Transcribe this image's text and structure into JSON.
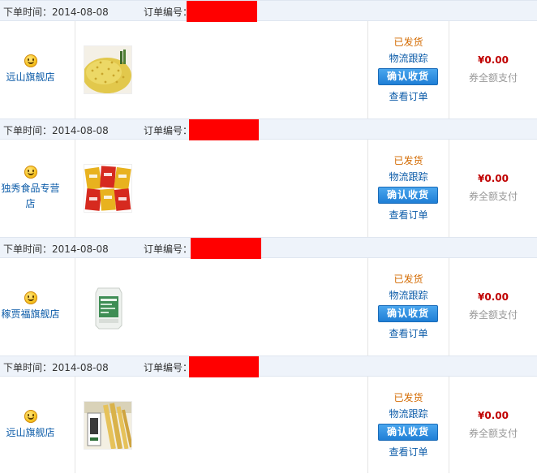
{
  "labels": {
    "date_prefix": "下单时间：",
    "order_no_label": "订单编号：",
    "status": "已发货",
    "track": "物流跟踪",
    "confirm": "确认收货",
    "view": "查看订单",
    "amount": "¥0.00",
    "paytype": "券全额支付"
  },
  "colors": {
    "header_bg": "#eef3fa",
    "redaction": "#ff0000",
    "status": "#d36a00",
    "link": "#0b5ba8",
    "price": "#c00000",
    "button": "#1f7fd6"
  },
  "orders": [
    {
      "date": "2014-08-08",
      "shop": "远山旗舰店",
      "product_icon": "millet-grain-image"
    },
    {
      "date": "2014-08-08",
      "shop": "独秀食品专营店",
      "product_icon": "snack-packs-image"
    },
    {
      "date": "2014-08-08",
      "shop": "稼贾福旗舰店",
      "product_icon": "rice-bag-image"
    },
    {
      "date": "2014-08-08",
      "shop": "远山旗舰店",
      "product_icon": "tofu-skin-sticks-image"
    }
  ]
}
